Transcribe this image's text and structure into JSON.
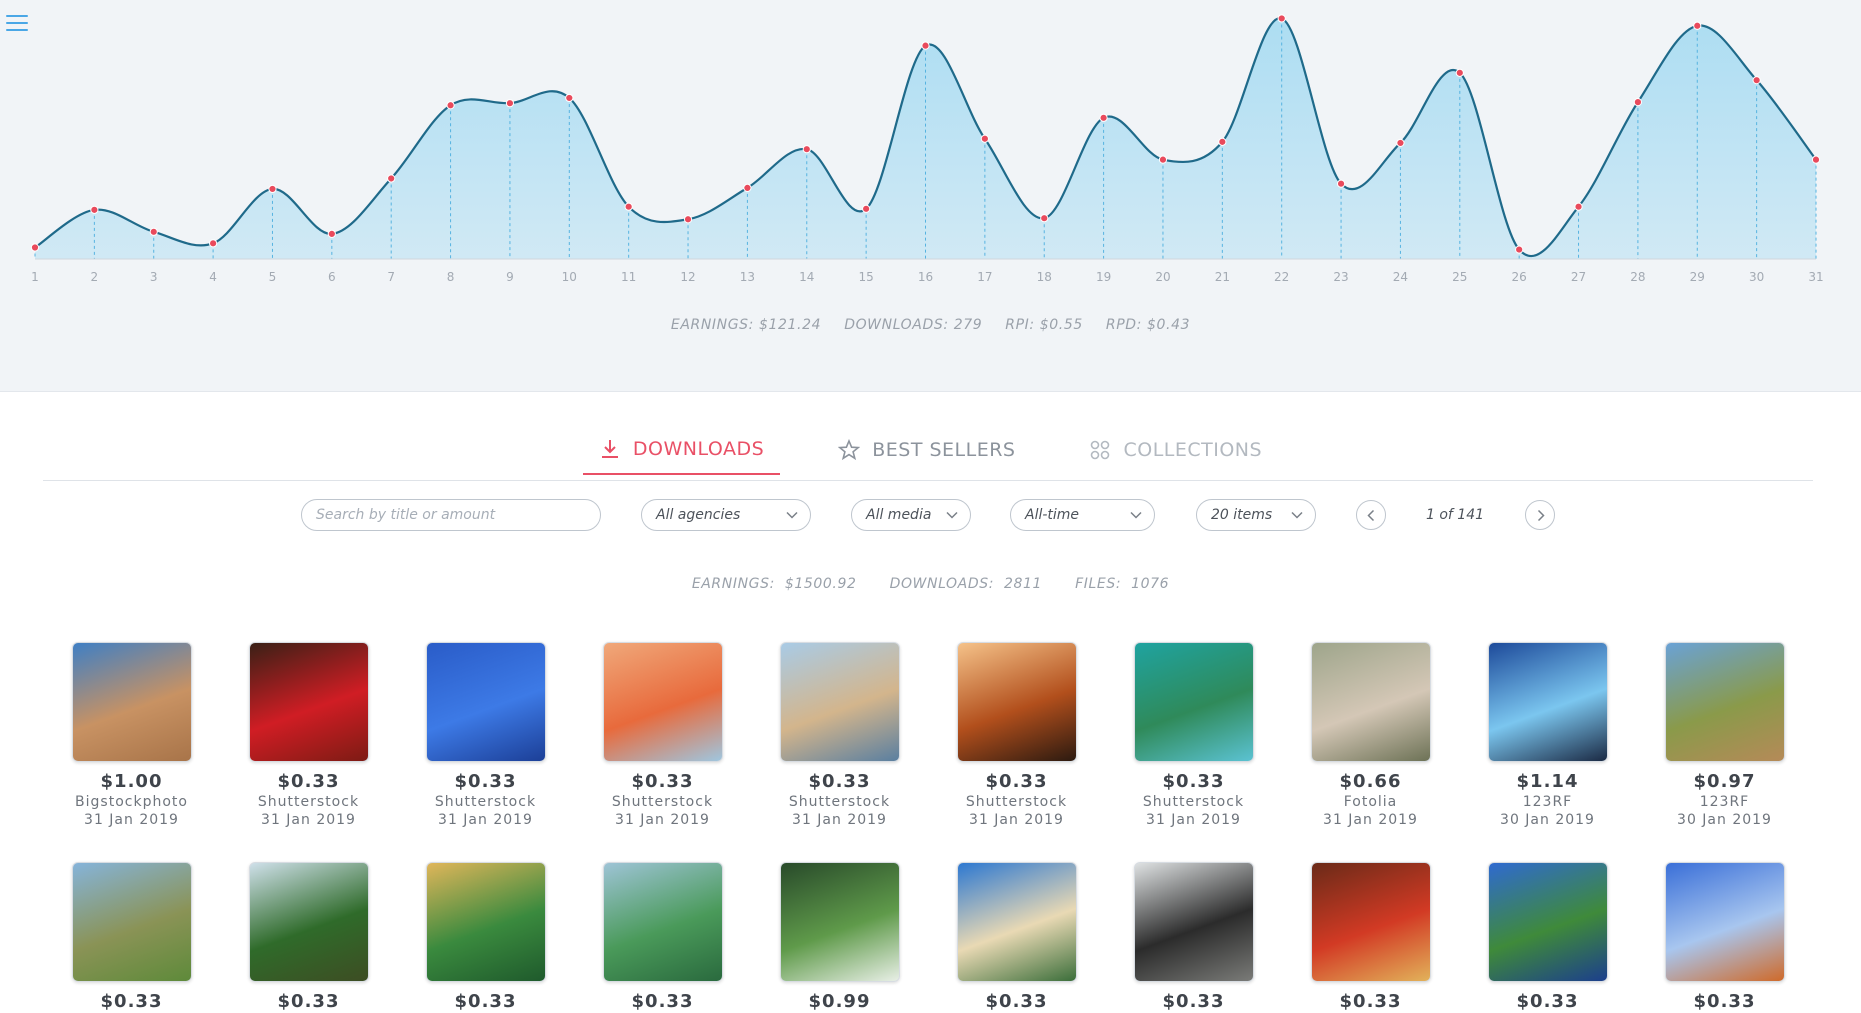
{
  "app": {
    "menu_icon": "hamburger-menu-icon"
  },
  "colors": {
    "accent": "#e95066",
    "chart_line": "#1f6a8a",
    "chart_fill": "#a9dcf2",
    "point": "#e94a5c",
    "link_blue": "#4aa7e6"
  },
  "chart_data": {
    "type": "area",
    "x": [
      1,
      2,
      3,
      4,
      5,
      6,
      7,
      8,
      9,
      10,
      11,
      12,
      13,
      14,
      15,
      16,
      17,
      18,
      19,
      20,
      21,
      22,
      23,
      24,
      25,
      26,
      27,
      28,
      29,
      30,
      31
    ],
    "series": [
      {
        "values": [
          1.1,
          4.7,
          2.6,
          1.5,
          6.7,
          2.4,
          7.7,
          14.7,
          14.9,
          15.4,
          5.0,
          3.8,
          6.8,
          10.5,
          4.8,
          20.4,
          11.5,
          3.9,
          13.5,
          9.5,
          11.2,
          23.0,
          7.2,
          11.1,
          17.8,
          0.9,
          5.0,
          15.0,
          22.3,
          17.1,
          9.5
        ]
      }
    ],
    "xlabel": "",
    "ylabel": "",
    "ylim": [
      0,
      24
    ],
    "grid": false,
    "legend": false
  },
  "chart_summary": {
    "earnings": "EARNINGS: $121.24",
    "downloads": "DOWNLOADS: 279",
    "rpi": "RPI: $0.55",
    "rpd": "RPD: $0.43"
  },
  "tabs": [
    {
      "label": "DOWNLOADS",
      "icon": "download-icon",
      "active": true
    },
    {
      "label": "BEST SELLERS",
      "icon": "star-icon",
      "active": false
    },
    {
      "label": "COLLECTIONS",
      "icon": "grid-icon",
      "active": false
    }
  ],
  "filters": {
    "search_placeholder": "Search by title or amount",
    "agency": "All agencies",
    "media": "All media",
    "period": "All-time",
    "page_size": "20 items",
    "page_indicator": "1 of 141"
  },
  "totals": {
    "earnings_label": "EARNINGS:",
    "earnings_value": "$1500.92",
    "downloads_label": "DOWNLOADS:",
    "downloads_value": "2811",
    "files_label": "FILES:",
    "files_value": "1076"
  },
  "items": [
    {
      "price": "$1.00",
      "agency": "Bigstockphoto",
      "date": "31 Jan 2019",
      "palette": [
        "#3f7fc4",
        "#c89263",
        "#a87449"
      ]
    },
    {
      "price": "$0.33",
      "agency": "Shutterstock",
      "date": "31 Jan 2019",
      "palette": [
        "#3a2016",
        "#d01d24",
        "#7d1b14"
      ]
    },
    {
      "price": "$0.33",
      "agency": "Shutterstock",
      "date": "31 Jan 2019",
      "palette": [
        "#2a5cc8",
        "#3d7ae6",
        "#1c3f97"
      ]
    },
    {
      "price": "$0.33",
      "agency": "Shutterstock",
      "date": "31 Jan 2019",
      "palette": [
        "#f0a87a",
        "#e86a3c",
        "#9fc6df"
      ]
    },
    {
      "price": "$0.33",
      "agency": "Shutterstock",
      "date": "31 Jan 2019",
      "palette": [
        "#a9cbe6",
        "#d3b58c",
        "#5a7fa0"
      ]
    },
    {
      "price": "$0.33",
      "agency": "Shutterstock",
      "date": "31 Jan 2019",
      "palette": [
        "#f5c289",
        "#b24f1c",
        "#2c1a10"
      ]
    },
    {
      "price": "$0.33",
      "agency": "Shutterstock",
      "date": "31 Jan 2019",
      "palette": [
        "#1fa3a0",
        "#2f8a5a",
        "#5bc2d2"
      ]
    },
    {
      "price": "$0.66",
      "agency": "Fotolia",
      "date": "31 Jan 2019",
      "palette": [
        "#9ea58b",
        "#d4c7b6",
        "#6d7256"
      ]
    },
    {
      "price": "$1.14",
      "agency": "123RF",
      "date": "30 Jan 2019",
      "palette": [
        "#1d4a9a",
        "#7bc6ef",
        "#1b2a44"
      ]
    },
    {
      "price": "$0.97",
      "agency": "123RF",
      "date": "30 Jan 2019",
      "palette": [
        "#6aa2d6",
        "#8a9a4a",
        "#b58a58"
      ]
    },
    {
      "price": "$0.33",
      "palette": [
        "#86b4da",
        "#8a9356",
        "#5e8a3a"
      ]
    },
    {
      "price": "$0.33",
      "palette": [
        "#cfe0ea",
        "#2f6b2a",
        "#3d4d23"
      ]
    },
    {
      "price": "$0.33",
      "palette": [
        "#e0b65a",
        "#3a8a3e",
        "#1f5a2c"
      ]
    },
    {
      "price": "$0.33",
      "palette": [
        "#9ec4d6",
        "#4a9a5a",
        "#2a6a3e"
      ]
    },
    {
      "price": "$0.99",
      "palette": [
        "#284a2a",
        "#5f9a4a",
        "#e8efe6"
      ]
    },
    {
      "price": "$0.33",
      "palette": [
        "#2d78d1",
        "#e9d9b4",
        "#3b6e3a"
      ]
    },
    {
      "price": "$0.33",
      "palette": [
        "#dfe2e3",
        "#2b2b2b",
        "#7a7b78"
      ]
    },
    {
      "price": "$0.33",
      "palette": [
        "#6a2a18",
        "#d23a24",
        "#e2b25a"
      ]
    },
    {
      "price": "$0.33",
      "palette": [
        "#2f6ad0",
        "#3f8a3a",
        "#1c3f8c"
      ]
    },
    {
      "price": "$0.33",
      "palette": [
        "#3a6fd8",
        "#a8c6ef",
        "#cf6a2a"
      ]
    }
  ]
}
